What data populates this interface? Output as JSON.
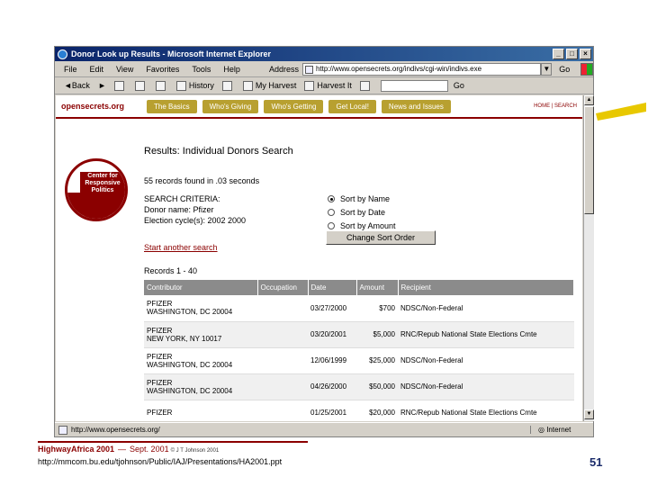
{
  "browser": {
    "title": "Donor Look up Results - Microsoft Internet Explorer",
    "menu": [
      "File",
      "Edit",
      "View",
      "Favorites",
      "Tools",
      "Help"
    ],
    "address_label": "Address",
    "address": "http://www.opensecrets.org/indivs/cgi-win/indivs.exe",
    "go_label": "Go",
    "toolbar": [
      "Back",
      "History",
      "My Harvest",
      "Harvest It"
    ],
    "search_go": "Go",
    "status_url": "http://www.opensecrets.org/",
    "status_zone": "Internet"
  },
  "site": {
    "logo": "opensecrets.org",
    "nav": [
      "The Basics",
      "Who's Giving",
      "Who's Getting",
      "Get Local!",
      "News and Issues"
    ],
    "nav_right": "HOME | SEARCH",
    "badge_text": "Center for Responsive Politics"
  },
  "results": {
    "title": "Results: Individual Donors Search",
    "found": "55 records found in .03 seconds",
    "criteria_heading": "SEARCH CRITERIA:",
    "criteria": [
      "Donor name: Pfizer",
      "Election cycle(s): 2002 2000"
    ],
    "sort_options": [
      "Sort by Name",
      "Sort by Date",
      "Sort by Amount"
    ],
    "sort_button": "Change Sort Order",
    "new_search": "Start another search",
    "range": "Records 1 - 40",
    "columns": [
      "Contributor",
      "Occupation",
      "Date",
      "Amount",
      "Recipient"
    ],
    "rows": [
      {
        "contributor": "PFIZER",
        "location": "WASHINGTON, DC 20004",
        "occupation": "",
        "date": "03/27/2000",
        "amount": "$700",
        "recipient": "NDSC/Non-Federal"
      },
      {
        "contributor": "PFIZER",
        "location": "NEW YORK, NY 10017",
        "occupation": "",
        "date": "03/20/2001",
        "amount": "$5,000",
        "recipient": "RNC/Repub National State Elections Cmte"
      },
      {
        "contributor": "PFIZER",
        "location": "WASHINGTON, DC 20004",
        "occupation": "",
        "date": "12/06/1999",
        "amount": "$25,000",
        "recipient": "NDSC/Non-Federal"
      },
      {
        "contributor": "PFIZER",
        "location": "WASHINGTON, DC 20004",
        "occupation": "",
        "date": "04/26/2000",
        "amount": "$50,000",
        "recipient": "NDSC/Non-Federal"
      },
      {
        "contributor": "PFIZER",
        "location": "",
        "occupation": "",
        "date": "01/25/2001",
        "amount": "$20,000",
        "recipient": "RNC/Repub National State Elections Cmte"
      }
    ]
  },
  "footer": {
    "title": "HighwayAfrica 2001",
    "dash": "—",
    "date": "Sept. 2001",
    "copyright": "© J T Johnson 2001",
    "url": "http://mmcom.bu.edu/tjohnson/Public/IAJ/Presentations/HA2001.ppt",
    "page": "51"
  },
  "colors": {
    "accent": "#8b0000",
    "nav_tab": "#b8a030",
    "table_header": "#8b8b8b",
    "highlighter": "#e8c800"
  }
}
